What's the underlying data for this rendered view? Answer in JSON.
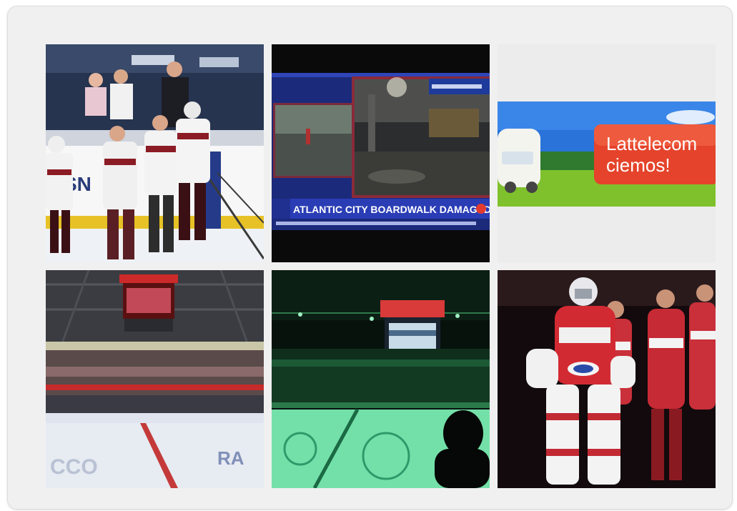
{
  "gallery": {
    "items": [
      {
        "name": "hockey players lined up on ice"
      },
      {
        "name": "news broadcast screenshot",
        "headline": "ATLANTIC CITY BOARDWALK DAMAGED"
      },
      {
        "name": "lattelecom advertisement banner",
        "banner_line1": "Lattelecom",
        "banner_line2": "ciemos!"
      },
      {
        "name": "hockey arena interior"
      },
      {
        "name": "arena with green-lit ice"
      },
      {
        "name": "hockey goalie and team"
      }
    ]
  }
}
